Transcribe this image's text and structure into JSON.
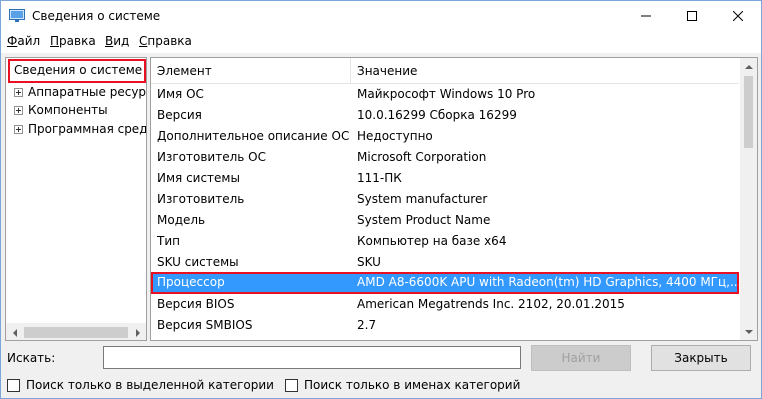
{
  "window": {
    "title": "Сведения о системе",
    "controls": {
      "minimize": "—",
      "maximize": "☐",
      "close": "✕"
    }
  },
  "menu": [
    {
      "label": "Файл",
      "accel": "Ф",
      "rest": "айл"
    },
    {
      "label": "Правка",
      "accel": "П",
      "rest": "равка"
    },
    {
      "label": "Вид",
      "accel": "В",
      "rest": "ид"
    },
    {
      "label": "Справка",
      "accel": "С",
      "rest": "правка"
    }
  ],
  "tree": {
    "root": "Сведения о системе",
    "nodes": [
      "Аппаратные ресурсы",
      "Компоненты",
      "Программная среда"
    ]
  },
  "list": {
    "columns": [
      "Элемент",
      "Значение"
    ],
    "rows": [
      {
        "item": "Имя ОС",
        "value": "Майкрософт Windows 10 Pro"
      },
      {
        "item": "Версия",
        "value": "10.0.16299 Сборка 16299"
      },
      {
        "item": "Дополнительное описание ОС",
        "value": "Недоступно"
      },
      {
        "item": "Изготовитель ОС",
        "value": "Microsoft Corporation"
      },
      {
        "item": "Имя системы",
        "value": "111-ПК"
      },
      {
        "item": "Изготовитель",
        "value": "System manufacturer"
      },
      {
        "item": "Модель",
        "value": "System Product Name"
      },
      {
        "item": "Тип",
        "value": "Компьютер на базе x64"
      },
      {
        "item": "SKU системы",
        "value": "SKU"
      },
      {
        "item": "Процессор",
        "value": "AMD A8-6600K APU with Radeon(tm) HD Graphics, 4400 МГц,..."
      },
      {
        "item": "Версия BIOS",
        "value": "American Megatrends Inc. 2102, 20.01.2015"
      },
      {
        "item": "Версия SMBIOS",
        "value": "2.7"
      }
    ],
    "selected_index": 9
  },
  "search": {
    "label": "Искать:",
    "value": "",
    "find_button": "Найти",
    "close_button": "Закрыть",
    "option_selected_category": "Поиск только в выделенной категории",
    "option_category_names": "Поиск только в именах категорий"
  },
  "colors": {
    "selection": "#3399ff",
    "highlight_border": "#e81123"
  }
}
